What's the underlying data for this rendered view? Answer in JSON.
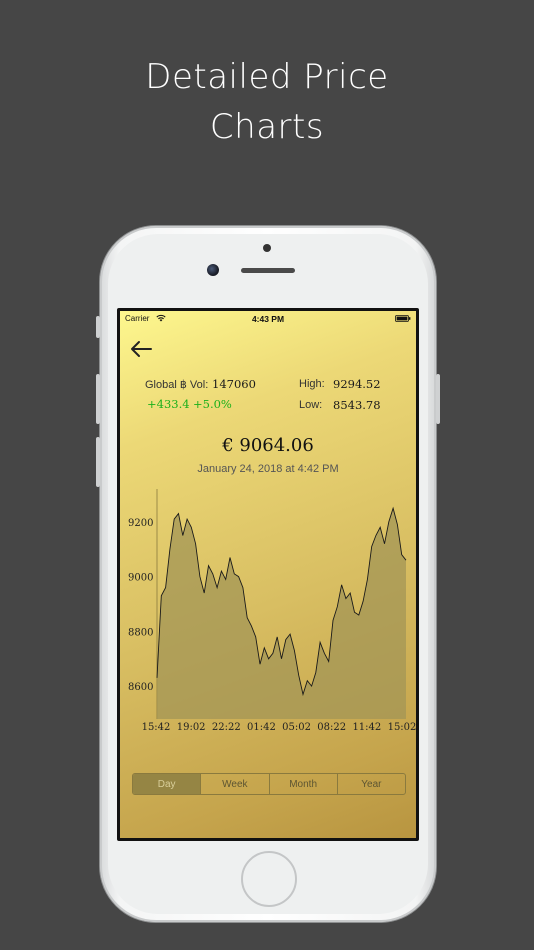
{
  "headline": {
    "line1": "Detailed Price",
    "line2": "Charts"
  },
  "status_bar": {
    "carrier": "Carrier",
    "time": "4:43 PM",
    "wifi_icon": "wifi-icon",
    "battery_icon": "battery-icon"
  },
  "nav": {
    "back_icon": "arrow-left-icon"
  },
  "stats": {
    "volume_label": "Global ฿ Vol:",
    "volume_value": "147060",
    "change_amount": "+433.4",
    "change_percent": "+5.0%",
    "high_label": "High:",
    "high_value": "9294.52",
    "low_label": "Low:",
    "low_value": "8543.78"
  },
  "price": {
    "value": "€ 9064.06",
    "timestamp": "January 24, 2018 at 4:42 PM"
  },
  "colors": {
    "accent_green": "#1bb01b",
    "area_fill": "#a39555",
    "line": "#1a1a1a"
  },
  "chart_data": {
    "type": "area",
    "x": [
      "15:42",
      "19:02",
      "22:22",
      "01:42",
      "05:02",
      "08:22",
      "11:42",
      "15:02"
    ],
    "y_ticks": [
      9200,
      9000,
      8800,
      8600
    ],
    "ylim": [
      8480,
      9320
    ],
    "values": [
      8630,
      8930,
      8960,
      9100,
      9210,
      9230,
      9150,
      9210,
      9180,
      9120,
      9000,
      8940,
      9040,
      9010,
      8960,
      9020,
      8990,
      9070,
      9010,
      9000,
      8960,
      8850,
      8820,
      8780,
      8680,
      8740,
      8700,
      8720,
      8780,
      8700,
      8770,
      8790,
      8730,
      8640,
      8570,
      8620,
      8600,
      8650,
      8760,
      8720,
      8690,
      8840,
      8890,
      8970,
      8920,
      8940,
      8870,
      8860,
      8910,
      8990,
      9110,
      9150,
      9180,
      9120,
      9200,
      9250,
      9190,
      9080,
      9060
    ]
  },
  "segmented_control": {
    "options": [
      "Day",
      "Week",
      "Month",
      "Year"
    ],
    "selected": "Day"
  }
}
